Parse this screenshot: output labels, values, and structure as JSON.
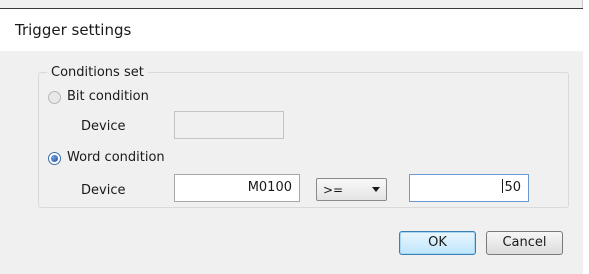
{
  "window": {
    "title": "Trigger settings"
  },
  "conditions_group": {
    "legend": "Conditions set",
    "bit_condition": {
      "label": "Bit condition",
      "selected": false,
      "device_label": "Device",
      "device_value": ""
    },
    "word_condition": {
      "label": "Word condition",
      "selected": true,
      "device_label": "Device",
      "device_value": "M0100",
      "operator": "&gt;=",
      "compare_value": "50"
    }
  },
  "buttons": {
    "ok_label": "OK",
    "cancel_label": "Cancel"
  },
  "colors": {
    "dialog_bg": "#f0f0f0",
    "default_button_border": "#3c7fb1",
    "selected_radio": "#1a4e9a"
  }
}
